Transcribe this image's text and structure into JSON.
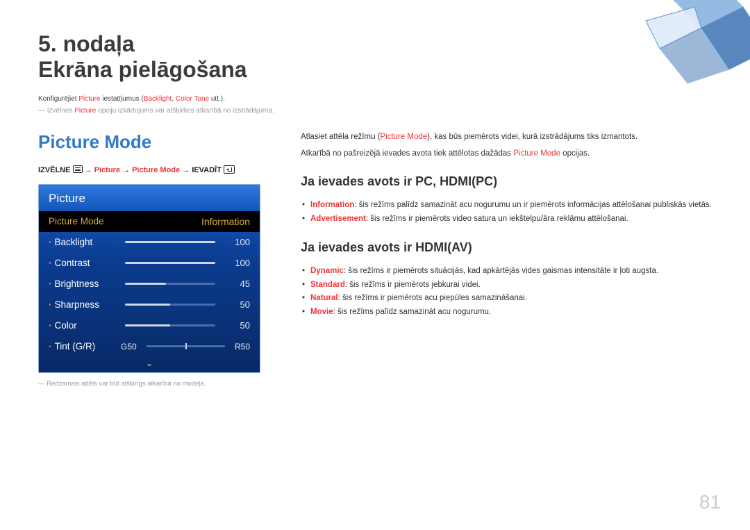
{
  "chapter": "5. nodaļa",
  "title": "Ekrāna pielāgošana",
  "intro": {
    "pre": "Konfigurējiet ",
    "hl1": "Picture",
    "mid": " iestatījumus (",
    "hl2": "Backlight",
    "sep": ", ",
    "hl3": "Color Tone",
    "post": " utt.)."
  },
  "note1": {
    "pre": "― Izvēlnes ",
    "hl": "Picture",
    "post": " opciju izkārtojums var atšķirties atkarībā no izstrādājuma."
  },
  "section": "Picture Mode",
  "breadcrumb": {
    "b0": "IZVĒLNE ",
    "b1": " → ",
    "p1": "Picture",
    "b2": " → ",
    "p2": "Picture Mode",
    "b3": " → IEVADĪT "
  },
  "osd": {
    "title": "Picture",
    "selected": {
      "label": "Picture Mode",
      "value": "Information"
    },
    "rows": [
      {
        "label": "Backlight",
        "value": "100",
        "fill": 100
      },
      {
        "label": "Contrast",
        "value": "100",
        "fill": 100
      },
      {
        "label": "Brightness",
        "value": "45",
        "fill": 45
      },
      {
        "label": "Sharpness",
        "value": "50",
        "fill": 50
      },
      {
        "label": "Color",
        "value": "50",
        "fill": 50
      }
    ],
    "tint": {
      "label": "Tint (G/R)",
      "left": "G50",
      "right": "R50"
    }
  },
  "caption": "― Redzamais attēls var būt atšķirīgs atkarībā no modeļa.",
  "intro_right": {
    "p1a": "Atlasiet attēla režīmu (",
    "p1b": "Picture Mode",
    "p1c": "), kas būs piemērots videi, kurā izstrādājums tiks izmantots.",
    "p2a": "Atkarībā no pašreizējā ievades avota tiek attēlotas dažādas ",
    "p2b": "Picture Mode",
    "p2c": " opcijas."
  },
  "sub1": "Ja ievades avots ir PC, HDMI(PC)",
  "list1": [
    {
      "hl": "Information",
      "text": ": šis režīms palīdz samazināt acu nogurumu un ir piemērots informācijas attēlošanai publiskās vietās."
    },
    {
      "hl": "Advertisement",
      "text": ": šis režīms ir piemērots video satura un iekštelpu/āra reklāmu attēlošanai."
    }
  ],
  "sub2": "Ja ievades avots ir HDMI(AV)",
  "list2": [
    {
      "hl": "Dynamic",
      "text": ": šis režīms ir piemērots situācijās, kad apkārtējās vides gaismas intensitāte ir ļoti augsta."
    },
    {
      "hl": "Standard",
      "text": ": šis režīms ir piemērots jebkurai videi."
    },
    {
      "hl": "Natural",
      "text": ": šis režīms ir piemērots acu piepūles samazināšanai."
    },
    {
      "hl": "Movie",
      "text": ": šis režīms palīdz samazināt acu nogurumu."
    }
  ],
  "page_number": "81"
}
